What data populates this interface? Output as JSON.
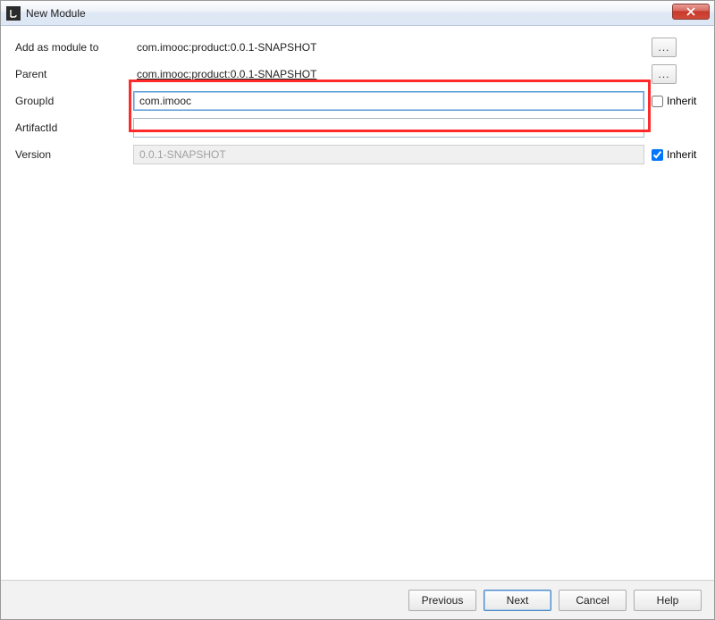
{
  "titlebar": {
    "title": "New Module"
  },
  "form": {
    "add_as_module_label": "Add as module to",
    "add_as_module_value": "com.imooc:product:0.0.1-SNAPSHOT",
    "parent_label": "Parent",
    "parent_value": "com.imooc:product:0.0.1-SNAPSHOT",
    "groupid_label": "GroupId",
    "groupid_value": "com.imooc",
    "artifactid_label": "ArtifactId",
    "artifactid_value": "",
    "version_label": "Version",
    "version_value": "0.0.1-SNAPSHOT",
    "inherit_label": "Inherit",
    "browse_ellipsis": "...",
    "groupid_inherit_checked": false,
    "version_inherit_checked": true
  },
  "buttons": {
    "previous": "Previous",
    "next": "Next",
    "cancel": "Cancel",
    "help": "Help"
  }
}
